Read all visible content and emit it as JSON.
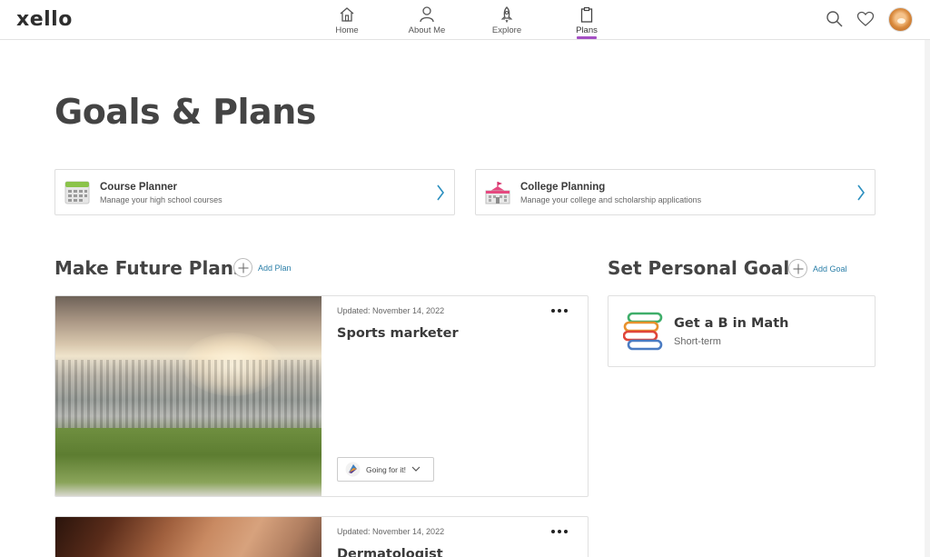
{
  "app": {
    "logo": "xello"
  },
  "nav": {
    "items": [
      {
        "label": "Home",
        "icon": "house-icon"
      },
      {
        "label": "About Me",
        "icon": "person-icon"
      },
      {
        "label": "Explore",
        "icon": "rocket-icon"
      },
      {
        "label": "Plans",
        "icon": "clipboard-icon",
        "active": true
      }
    ],
    "accent": "#a44fc4"
  },
  "page": {
    "title": "Goals & Plans"
  },
  "links": [
    {
      "title": "Course Planner",
      "subtitle": "Manage your high school courses",
      "icon": "calendar-icon"
    },
    {
      "title": "College Planning",
      "subtitle": "Manage your college and scholarship applications",
      "icon": "school-building-icon"
    }
  ],
  "plans_section": {
    "title": "Make Future Plans",
    "add_label": "Add Plan",
    "plans": [
      {
        "updated": "Updated: November 14, 2022",
        "title": "Sports marketer",
        "status": "Going for it!"
      },
      {
        "updated": "Updated: November 14, 2022",
        "title": "Dermatologist"
      }
    ]
  },
  "goals_section": {
    "title": "Set Personal Goals",
    "add_label": "Add Goal",
    "goals": [
      {
        "title": "Get a B in Math",
        "term": "Short-term",
        "icon": "books-icon"
      }
    ]
  },
  "colors": {
    "link": "#2b7fa8",
    "arrow": "#2b8fbf"
  }
}
